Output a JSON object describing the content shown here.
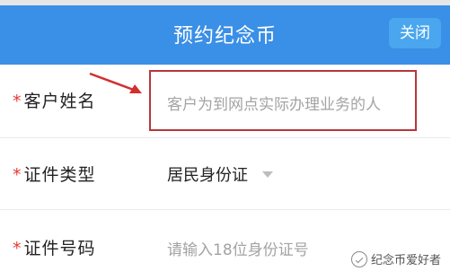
{
  "header": {
    "title": "预约纪念币",
    "close_label": "关闭"
  },
  "form": {
    "name": {
      "label": "客户姓名",
      "required_mark": "*",
      "placeholder": "客户为到网点实际办理业务的人"
    },
    "id_type": {
      "label": "证件类型",
      "required_mark": "*",
      "value": "居民身份证"
    },
    "id_number": {
      "label": "证件号码",
      "required_mark": "*",
      "placeholder": "请输入18位身份证号"
    }
  },
  "watermark": {
    "text": "纪念币爱好者"
  },
  "colors": {
    "header_bg": "#3a8fe6",
    "close_bg": "#4aa6ee",
    "required": "#e53935",
    "highlight_border": "#b5373c",
    "arrow": "#d32f2f"
  }
}
